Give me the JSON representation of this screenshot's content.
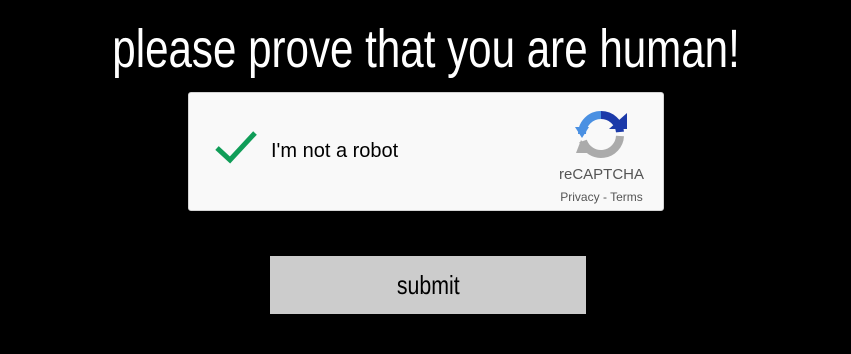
{
  "page": {
    "title": "please prove that you are human!"
  },
  "recaptcha": {
    "checkbox_state": "checked",
    "label": "I'm not a robot",
    "brand": "reCAPTCHA",
    "privacy_link": "Privacy",
    "separator": " - ",
    "terms_link": "Terms",
    "icons": {
      "check": "checkmark-icon",
      "logo": "recaptcha-logo-icon"
    }
  },
  "form": {
    "submit_label": "submit"
  },
  "colors": {
    "background": "#000000",
    "title_text": "#ffffff",
    "widget_background": "#f9f9f9",
    "widget_border": "#d3d3d3",
    "checkmark": "#109d58",
    "logo_blue_dark": "#1c3aa9",
    "logo_blue_light": "#4a90e2",
    "logo_gray": "#ababab",
    "button_background": "#cccccc"
  }
}
